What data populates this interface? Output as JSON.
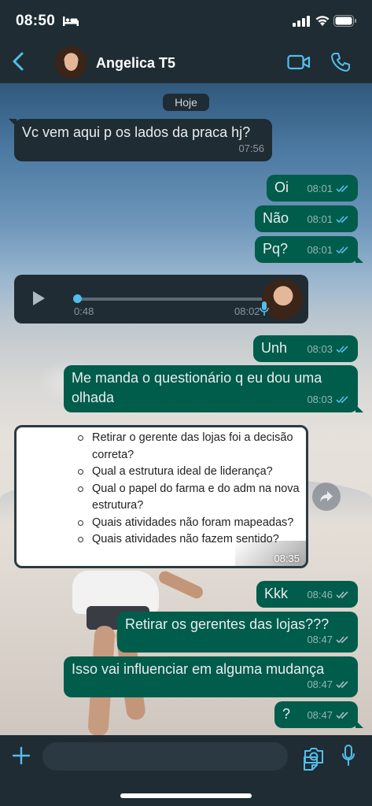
{
  "status_bar": {
    "time": "08:50"
  },
  "header": {
    "contact_name": "Angelica T5"
  },
  "date_separator": "Hoje",
  "messages": [
    {
      "dir": "in",
      "text": "Vc vem aqui p os lados da praca hj?",
      "time": "07:56"
    },
    {
      "dir": "out",
      "text": "Oi",
      "time": "08:01"
    },
    {
      "dir": "out",
      "text": "Não",
      "time": "08:01"
    },
    {
      "dir": "out",
      "text": "Pq?",
      "time": "08:01"
    },
    {
      "dir": "out",
      "text": "Unh",
      "time": "08:03"
    },
    {
      "dir": "out",
      "text": "Me manda o questionário q eu dou uma olhada",
      "time": "08:03"
    },
    {
      "dir": "out",
      "text": "Kkk",
      "time": "08:46"
    },
    {
      "dir": "out",
      "text": "Retirar os gerentes das lojas???",
      "time": "08:47"
    },
    {
      "dir": "out",
      "text": "Isso vai influenciar em alguma mudança",
      "time": "08:47"
    },
    {
      "dir": "out",
      "text": "?",
      "time": "08:47"
    }
  ],
  "voice_message": {
    "elapsed": "0:48",
    "time": "08:02",
    "progress": 0.0
  },
  "image_message": {
    "time": "08:35",
    "lines": [
      "Retirar o gerente das lojas foi a decisão correta?",
      "Qual a estrutura ideal de liderança?",
      "Qual o papel do farma e do adm na nova estrutura?",
      "Quais atividades não foram mapeadas?",
      "Quais atividades não fazem sentido?"
    ]
  },
  "colors": {
    "incoming": "#1f2c33",
    "outgoing": "#005c4b",
    "accent": "#53bdeb"
  }
}
